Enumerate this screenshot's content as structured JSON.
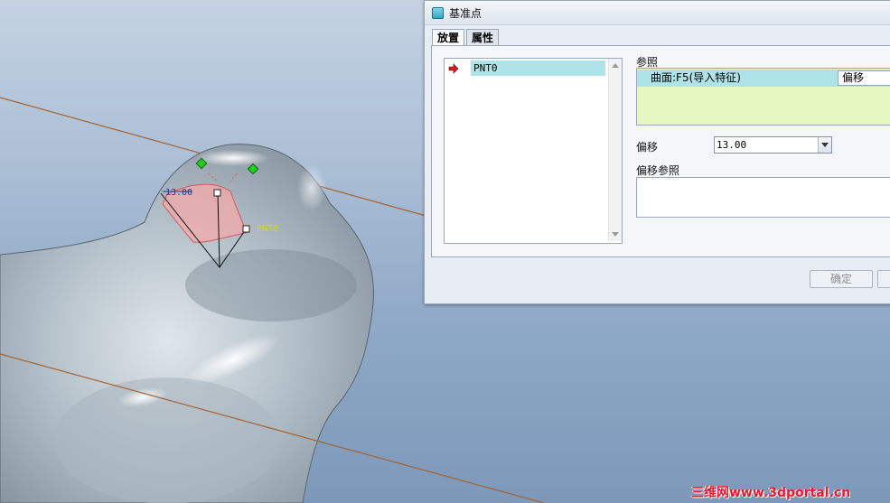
{
  "viewport": {
    "dimension_label": "13.00",
    "point_label": "PNT0",
    "colors": {
      "model": "#b7c3cc",
      "datum_line": "#a46434",
      "highlight": "#f3a9aa",
      "label_point": "#d4dd00",
      "handle": "#22cc22"
    }
  },
  "dialog": {
    "title": "基准点",
    "title_icon": "datum-point-icon",
    "tabs": [
      {
        "label": "放置",
        "active": true
      },
      {
        "label": "属性",
        "active": false
      }
    ],
    "collector": {
      "arrow_icon": "red-arrow-icon",
      "items": [
        "PNT0"
      ]
    },
    "references": {
      "label": "参照",
      "rows": [
        {
          "name": "曲面:F5(导入特征)",
          "type": "偏移"
        }
      ]
    },
    "offset": {
      "label": "偏移",
      "value": "13.00"
    },
    "offset_references": {
      "label": "偏移参照"
    },
    "buttons": {
      "ok": "确定",
      "cancel": ""
    }
  },
  "watermark": "三维网www.3dportal.cn"
}
